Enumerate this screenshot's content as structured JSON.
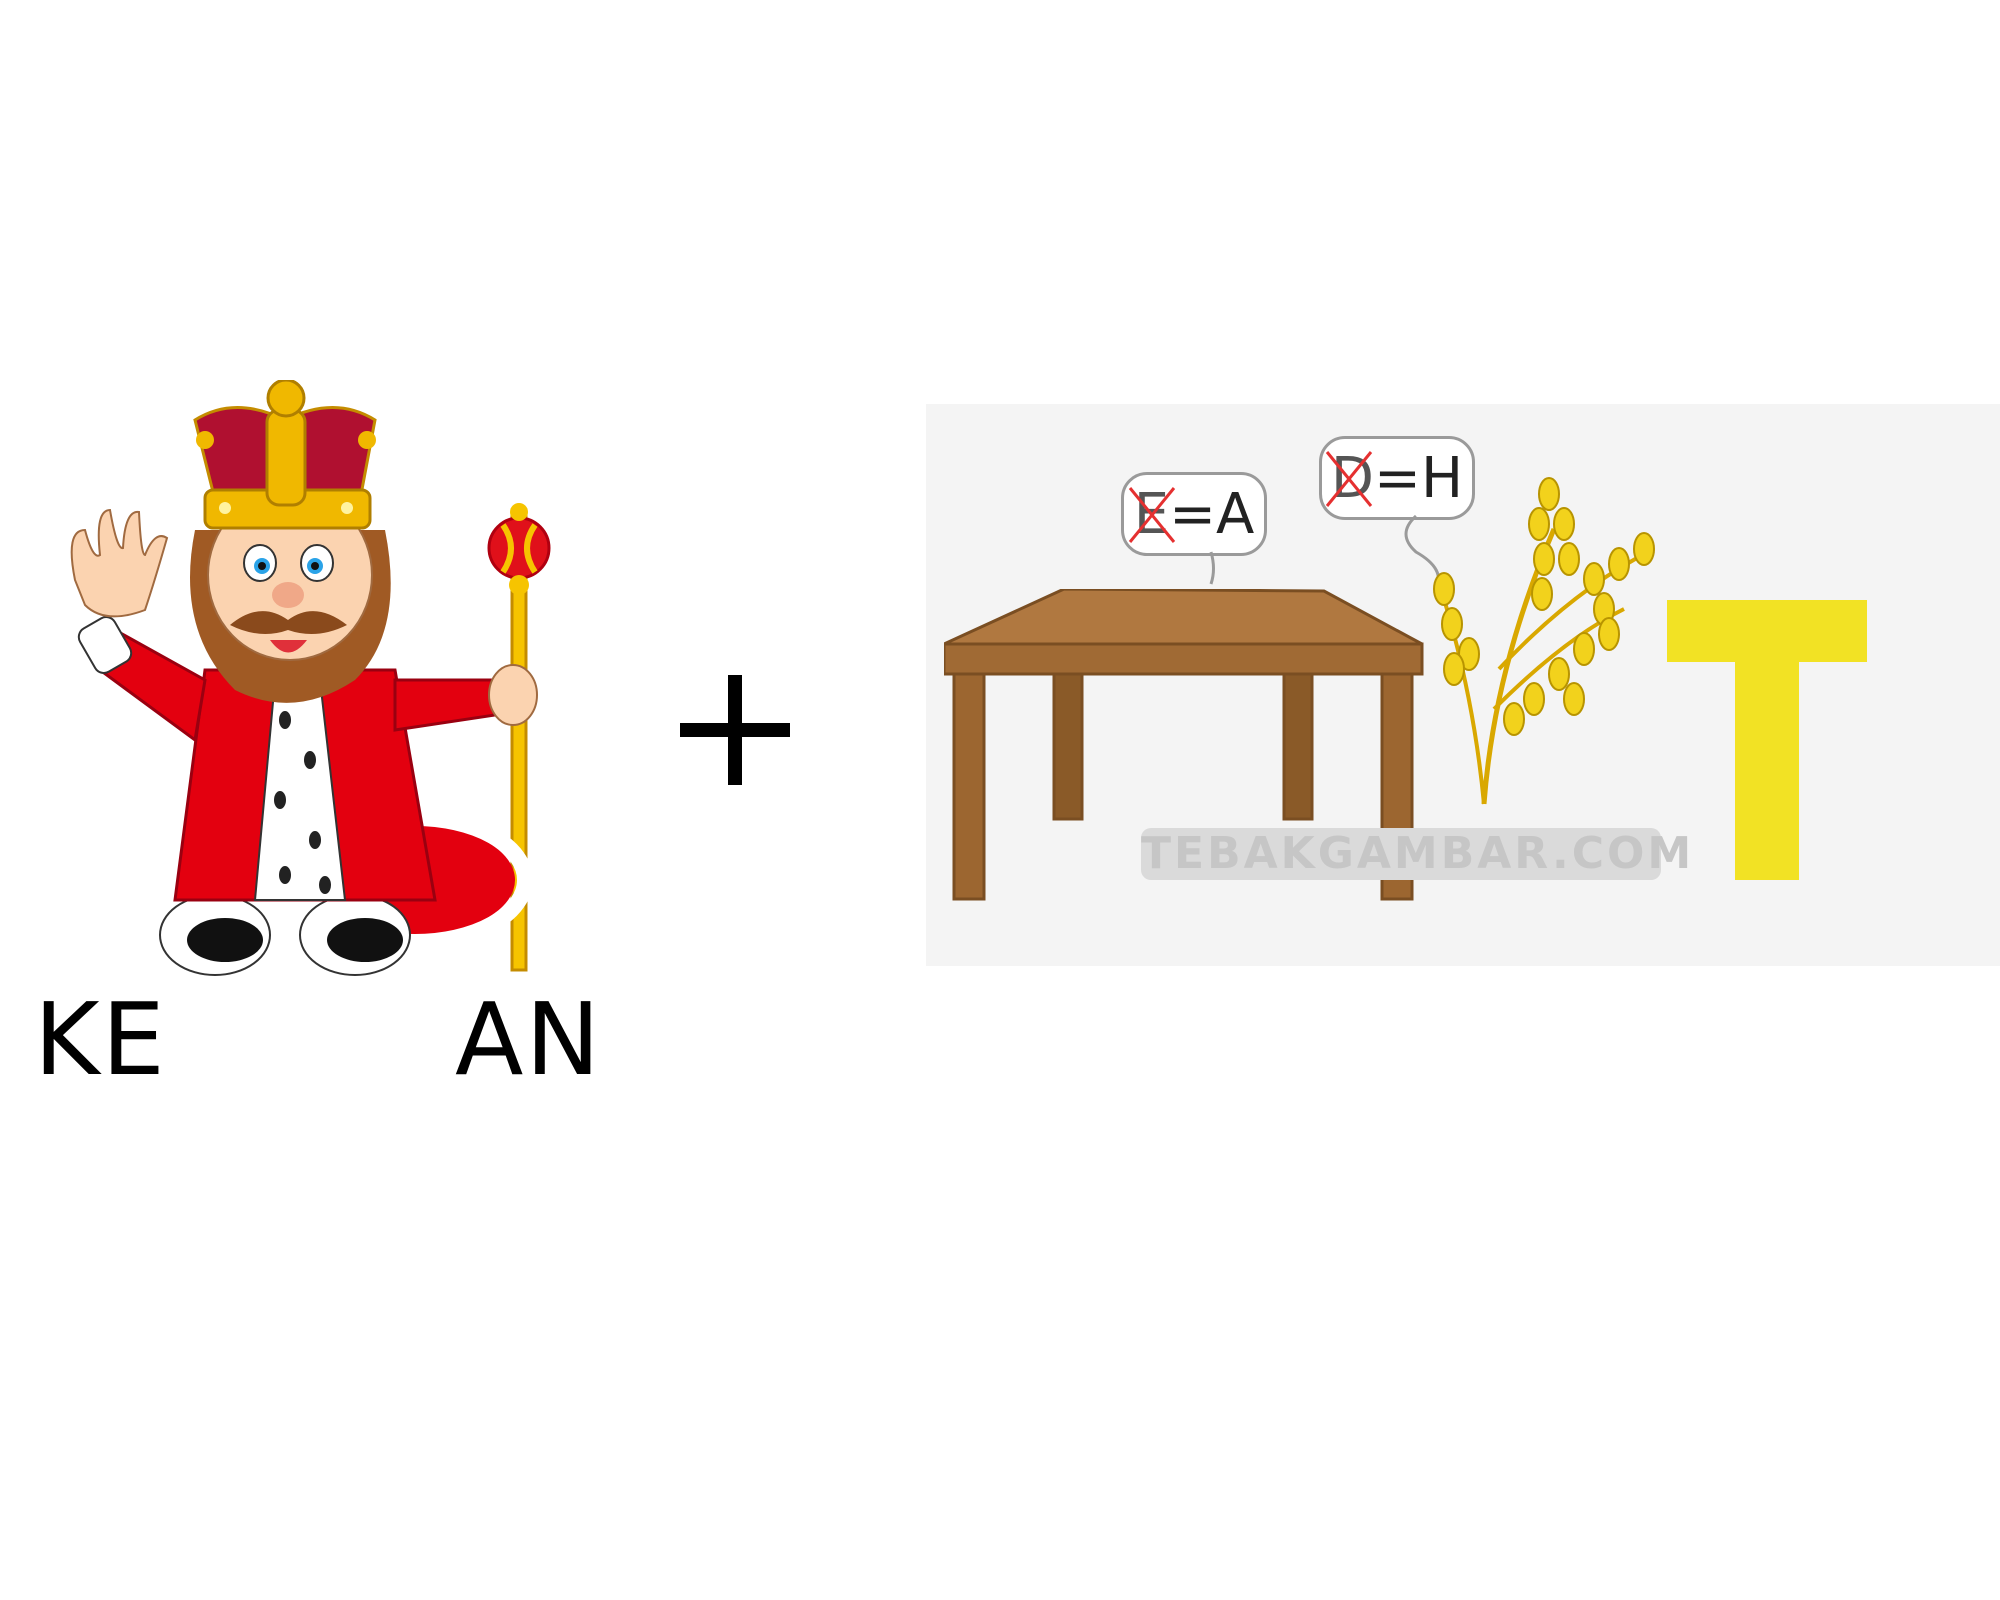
{
  "puzzle": {
    "left": {
      "prefix": "KE",
      "suffix": "AN",
      "picture": "king-with-crown-and-scepter"
    },
    "operator": "+",
    "right": {
      "picture": "table-and-rice-stalk",
      "bubble1": {
        "crossed": "E",
        "replacement": "A"
      },
      "bubble2": {
        "crossed": "D",
        "replacement": "H"
      },
      "equals": "=",
      "watermark": "TEBAKGAMBAR.COM",
      "letter": "T"
    }
  },
  "colors": {
    "robe": "#e3000f",
    "crown": "#f0b800",
    "table": "#b07840",
    "rice": "#f2d21c",
    "letter_t": "#f2e224"
  }
}
